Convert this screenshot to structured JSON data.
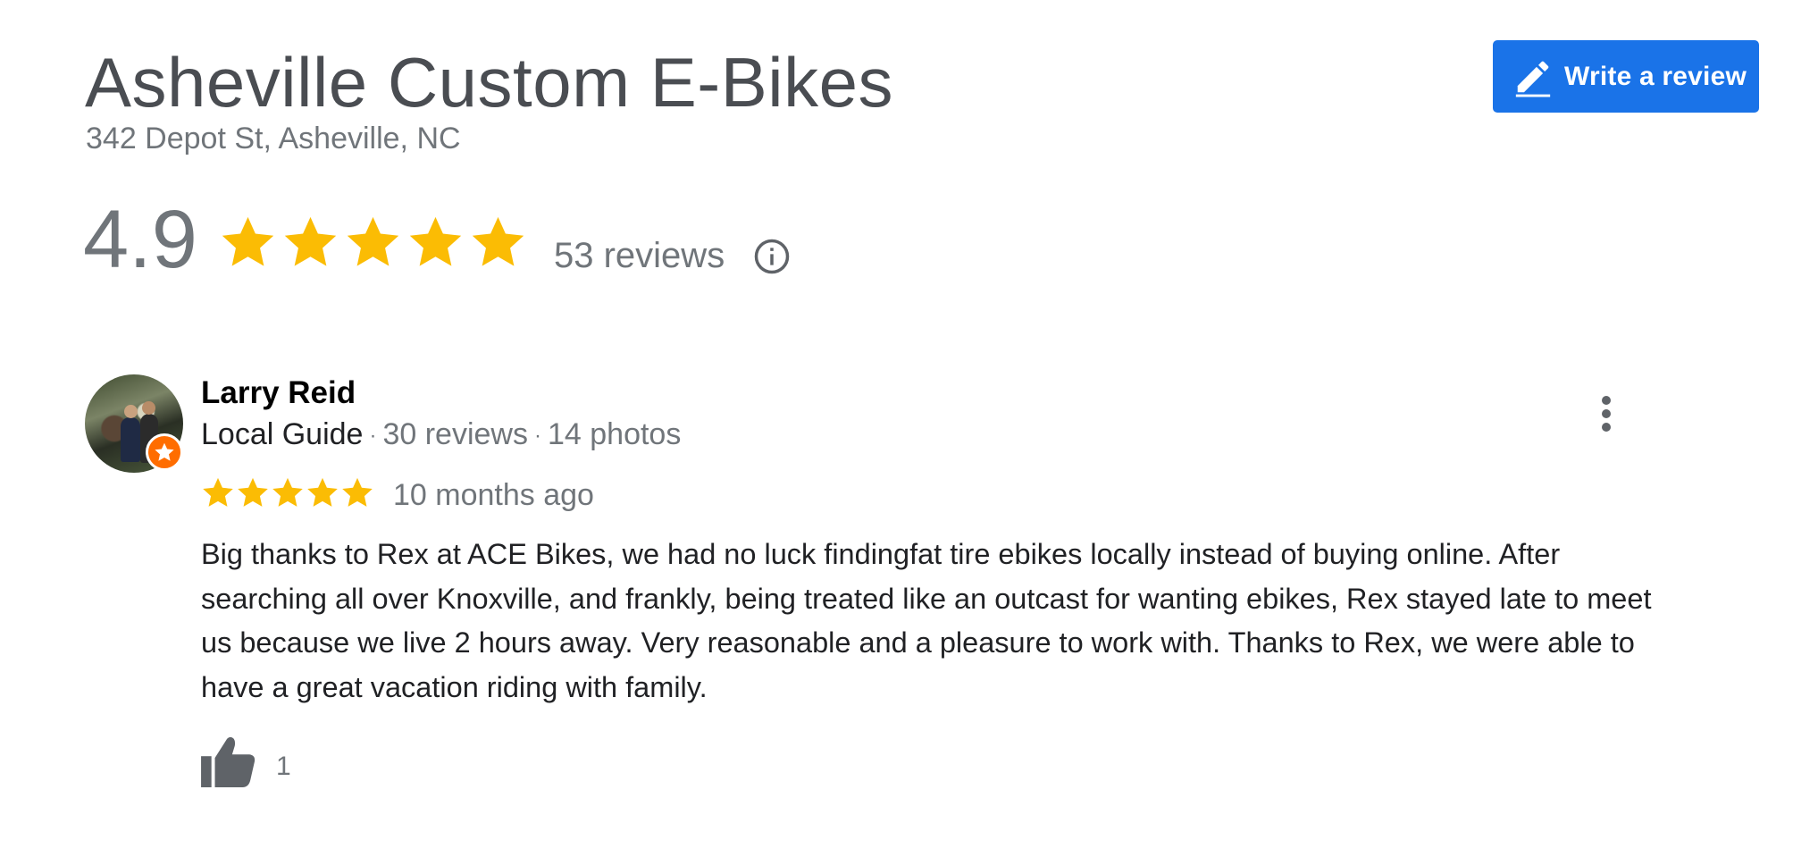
{
  "business": {
    "name": "Asheville Custom E-Bikes",
    "address": "342 Depot St, Asheville, NC"
  },
  "write_review": {
    "label": "Write a review",
    "icon": "pencil-icon"
  },
  "summary": {
    "rating": "4.9",
    "stars": 5,
    "review_count": "53 reviews",
    "info_icon": "info-icon"
  },
  "review": {
    "reviewer_name": "Larry Reid",
    "guide_label": "Local Guide",
    "separator": "·",
    "reviewer_reviews": "30 reviews",
    "reviewer_photos": "14 photos",
    "stars": 5,
    "time": "10 months ago",
    "text": "Big thanks to Rex at ACE Bikes, we had no luck findingfat tire ebikes locally instead of buying online. After searching all over Knoxville, and frankly, being treated like an outcast for wanting ebikes, Rex stayed late to meet us because we live 2 hours away. Very reasonable and a pleasure to work with. Thanks to Rex, we were able to have a great vacation riding with family.",
    "likes": "1"
  },
  "colors": {
    "star": "#fbbc04",
    "accent": "#1a73e8",
    "badge": "#ff6d00",
    "muted_text": "#70757a",
    "heading_text": "#4a4d52"
  }
}
